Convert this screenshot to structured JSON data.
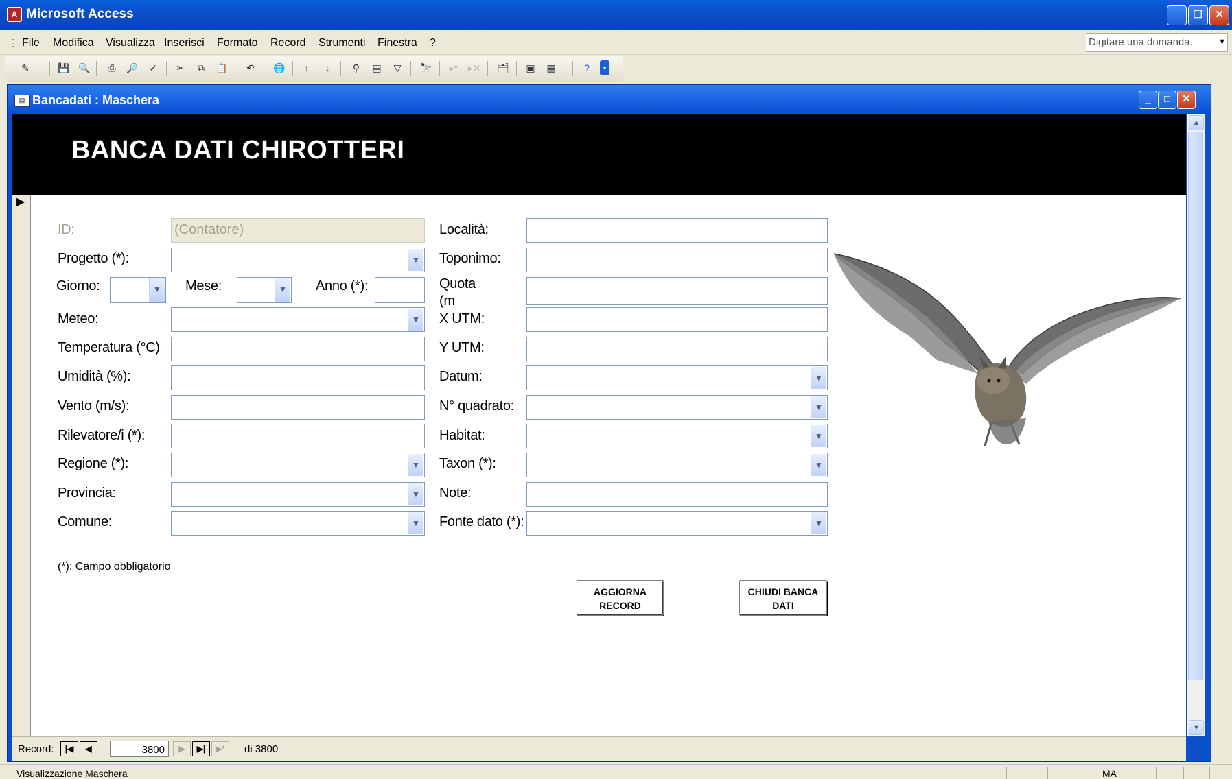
{
  "app": {
    "title": "Microsoft Access"
  },
  "menu": {
    "items": [
      "File",
      "Modifica",
      "Visualizza",
      "Inserisci",
      "Formato",
      "Record",
      "Strumenti",
      "Finestra",
      "?"
    ],
    "help_placeholder": "Digitare una domanda."
  },
  "child_window": {
    "title": "Bancadati : Maschera"
  },
  "form": {
    "title": "BANCA DATI CHIROTTERI",
    "left_fields": {
      "id_label": "ID:",
      "id_value": "(Contatore)",
      "progetto": "Progetto (*):",
      "giorno": "Giorno:",
      "mese": "Mese:",
      "anno": "Anno (*):",
      "meteo": "Meteo:",
      "temperatura": "Temperatura (°C)",
      "umidita": "Umidità (%):",
      "vento": "Vento (m/s):",
      "rilevatore": "Rilevatore/i (*):",
      "regione": "Regione (*):",
      "provincia": "Provincia:",
      "comune": "Comune:"
    },
    "right_fields": {
      "localita": "Località:",
      "toponimo": "Toponimo:",
      "quota_line1": "Quota",
      "quota_line2": "(m",
      "x_utm": "X UTM:",
      "y_utm": "Y UTM:",
      "datum": "Datum:",
      "quadrato": "N° quadrato:",
      "habitat": "Habitat:",
      "taxon": "Taxon (*):",
      "note": "Note:",
      "fonte": "Fonte dato (*):"
    },
    "required_note": "(*): Campo obbligatorio",
    "buttons": {
      "update_line1": "AGGIORNA",
      "update_line2": "RECORD",
      "close_line1": "CHIUDI BANCA",
      "close_line2": "DATI"
    }
  },
  "navigation": {
    "label": "Record:",
    "current": "3800",
    "total_text": "di 3800"
  },
  "status": {
    "text": "Visualizzazione Maschera",
    "indicator": "MA"
  },
  "icons": [
    "app-icon",
    "minimize-icon",
    "restore-icon",
    "close-icon",
    "form-icon",
    "dropdown-arrow-icon",
    "bat-image"
  ]
}
